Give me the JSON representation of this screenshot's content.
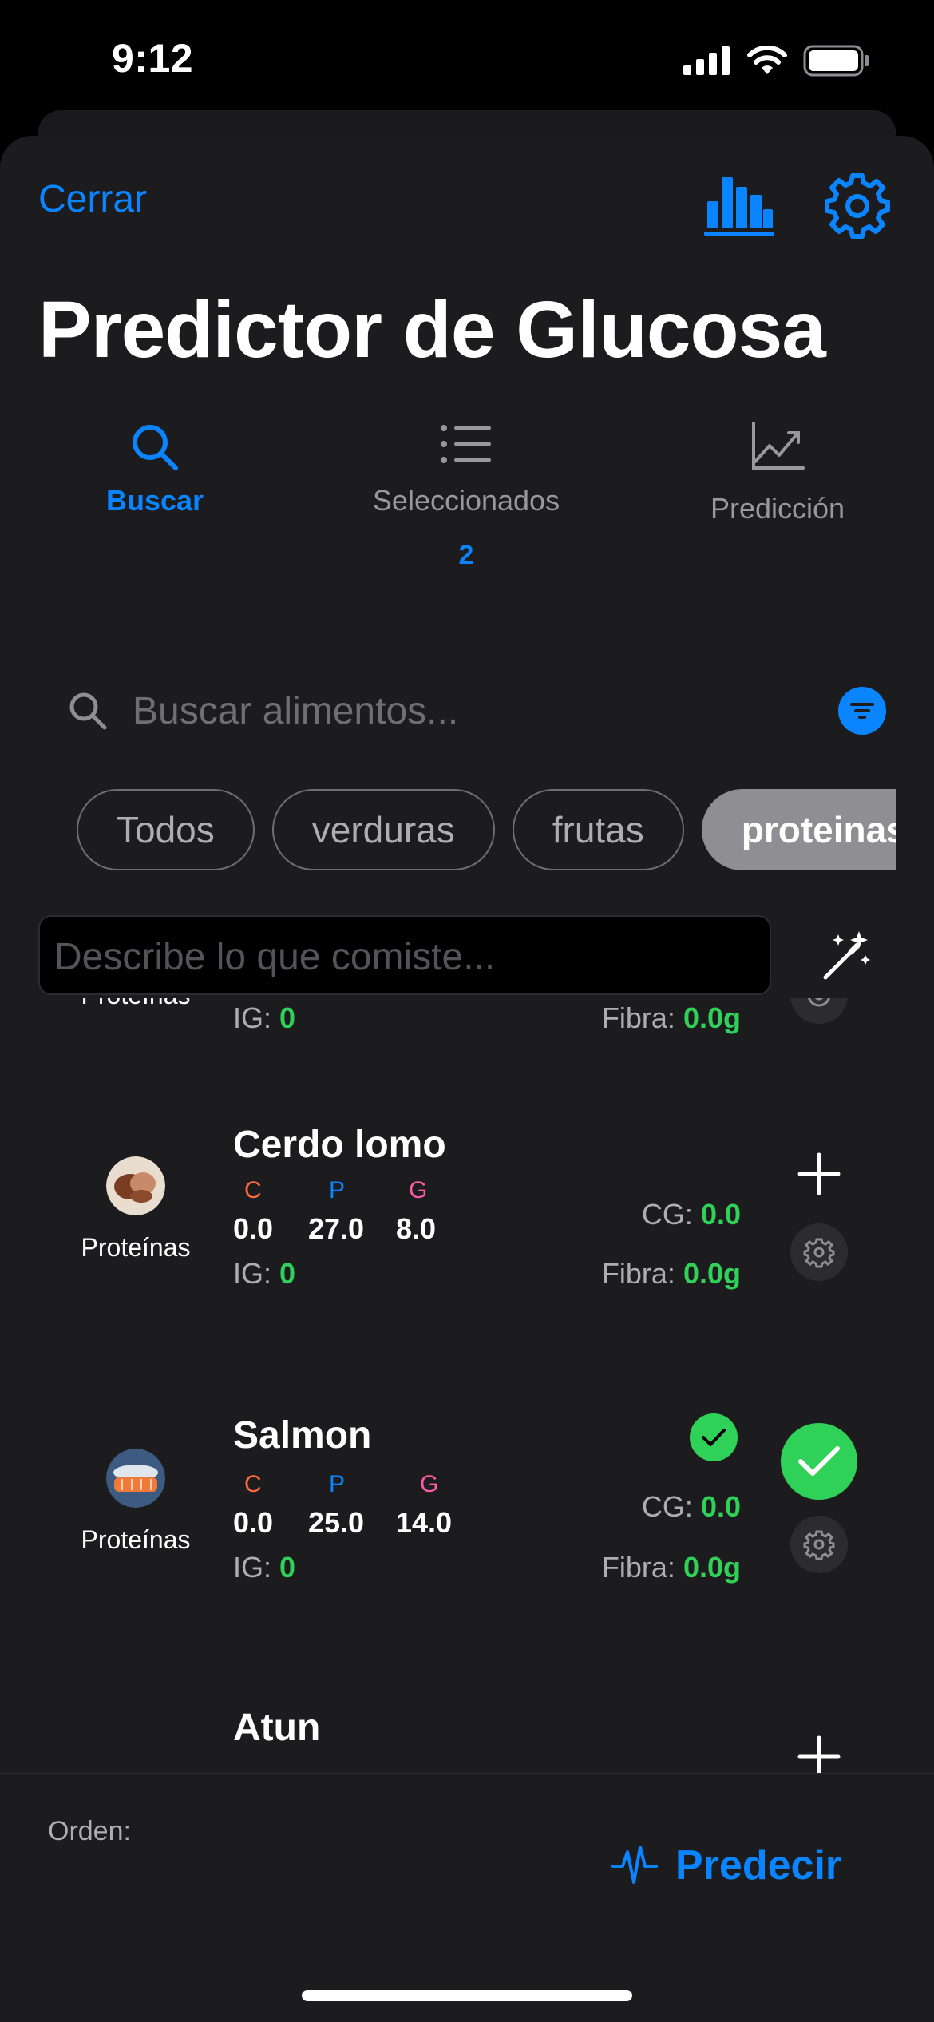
{
  "status": {
    "time": "9:12"
  },
  "nav": {
    "close_label": "Cerrar"
  },
  "title": "Predictor de Glucosa",
  "tabs": [
    {
      "label": "Buscar",
      "icon": "search-icon",
      "active": true
    },
    {
      "label": "Seleccionados",
      "icon": "list-icon",
      "badge": "2"
    },
    {
      "label": "Predicción",
      "icon": "chart-line-icon"
    }
  ],
  "search": {
    "placeholder": "Buscar alimentos..."
  },
  "chips": [
    "Todos",
    "verduras",
    "frutas",
    "proteinas"
  ],
  "describe": {
    "placeholder": "Describe lo que comiste..."
  },
  "partial_row": {
    "category": "Proteínas",
    "ig_label": "IG:",
    "ig": "0",
    "fiber_label": "Fibra:",
    "fiber": "0.0g"
  },
  "foods": [
    {
      "name": "Cerdo lomo",
      "category": "Proteínas",
      "c_label": "C",
      "p_label": "P",
      "g_label": "G",
      "c": "0.0",
      "p": "27.0",
      "g": "8.0",
      "ig_label": "IG:",
      "ig": "0",
      "cg_label": "CG:",
      "cg": "0.0",
      "fiber_label": "Fibra:",
      "fiber": "0.0g",
      "selected": false
    },
    {
      "name": "Salmon",
      "category": "Proteínas",
      "c_label": "C",
      "p_label": "P",
      "g_label": "G",
      "c": "0.0",
      "p": "25.0",
      "g": "14.0",
      "ig_label": "IG:",
      "ig": "0",
      "cg_label": "CG:",
      "cg": "0.0",
      "fiber_label": "Fibra:",
      "fiber": "0.0g",
      "selected": true
    },
    {
      "name": "Atun"
    }
  ],
  "bottom": {
    "order_label": "Orden:",
    "predict_label": "Predecir"
  },
  "colors": {
    "accent": "#0a84ff",
    "carbs": "#ff6b3d",
    "protein": "#0a84ff",
    "fat": "#ff5aa5",
    "positive": "#30d158"
  }
}
